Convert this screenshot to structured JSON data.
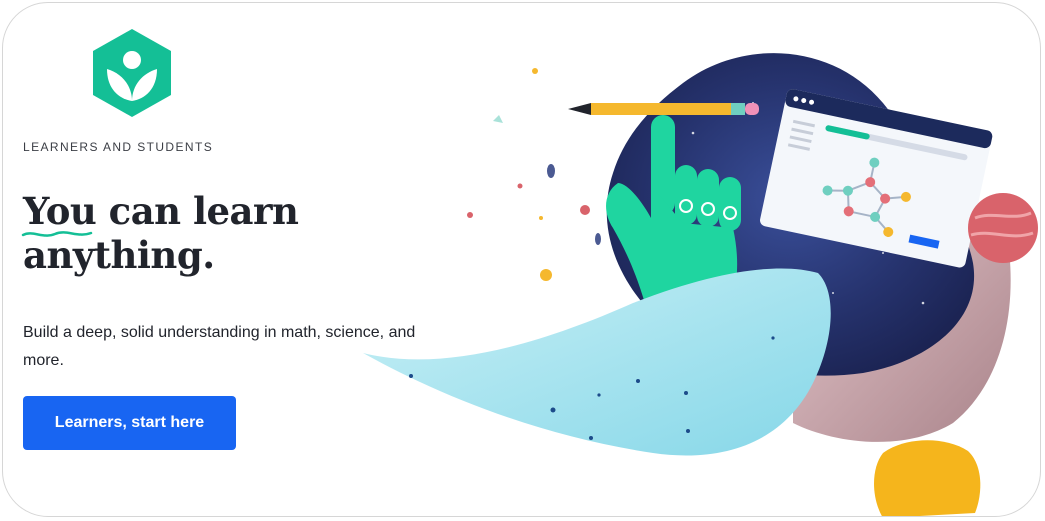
{
  "brand": {
    "logo_icon": "khan-academy-hexagon-logo",
    "color": "#14bf96"
  },
  "hero": {
    "eyebrow": "LEARNERS AND STUDENTS",
    "headline_part1": "You",
    "headline_part2": " can learn",
    "headline_part3": "anything.",
    "subtext": "Build a deep, solid understanding in math, science, and more.",
    "cta_label": "Learners, start here",
    "cta_color": "#1865f2"
  },
  "illustration": {
    "description_icons": [
      "pencil-icon",
      "hand-icon",
      "browser-window-icon",
      "molecule-icon",
      "planet-icon"
    ]
  }
}
